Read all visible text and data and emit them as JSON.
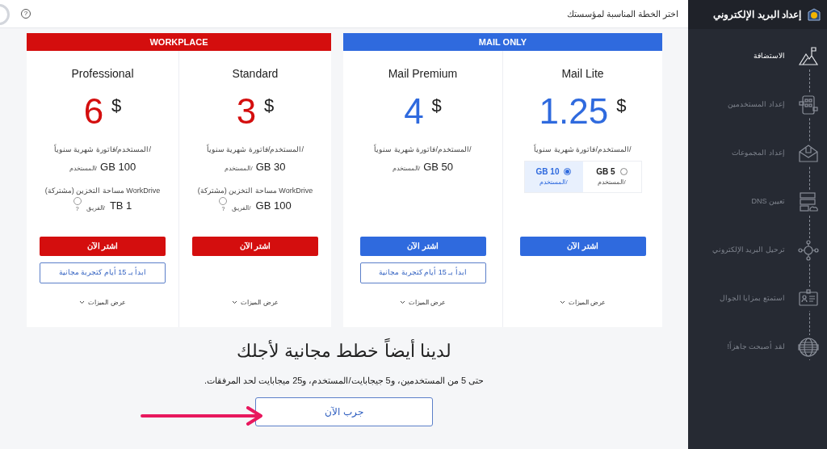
{
  "top_bar": {
    "title": "اختر الخطة المناسبة لمؤسستك",
    "help": "?"
  },
  "plan_groups": [
    {
      "label": "MAIL ONLY",
      "color": "#2f6ade",
      "plans": [
        {
          "name": "Mail Lite",
          "price": "1.25",
          "currency": "$",
          "billing": "/المستخدم/فاتورة شهرية سنوياً",
          "storage_options": [
            {
              "value": "GB 5",
              "unit": "/المستخدم",
              "selected": false
            },
            {
              "value": "GB 10",
              "unit": "/المستخدم",
              "selected": true
            }
          ],
          "buy_button": "اشتر الآن",
          "features_link": "عرض الميزات"
        },
        {
          "name": "Mail Premium",
          "price": "4",
          "currency": "$",
          "billing": "/المستخدم/فاتورة شهرية سنوياً",
          "storage": {
            "value": "GB 50",
            "unit": "/المستخدم"
          },
          "buy_button": "اشتر الآن",
          "trial_button": "ابدأ بـ 15 أيام كتجربة مجانية",
          "features_link": "عرض الميزات"
        }
      ]
    },
    {
      "label": "WORKPLACE",
      "color": "#d40e0e",
      "plans": [
        {
          "name": "Standard",
          "price": "3",
          "currency": "$",
          "billing": "/المستخدم/فاتورة شهرية سنوياً",
          "storage": {
            "value": "GB 30",
            "unit": "/المستخدم"
          },
          "workdrive": {
            "label": "WorkDrive مساحة التخزين (مشتركة)",
            "value": "GB 100",
            "unit": "/الفريق",
            "help": "?",
            "checked": false
          },
          "buy_button": "اشتر الآن",
          "features_link": "عرض الميزات"
        },
        {
          "name": "Professional",
          "price": "6",
          "currency": "$",
          "billing": "/المستخدم/فاتورة شهرية سنوياً",
          "storage": {
            "value": "GB 100",
            "unit": "/المستخدم"
          },
          "workdrive": {
            "label": "WorkDrive مساحة التخزين (مشتركة)",
            "value": "TB 1",
            "unit": "/الفريق",
            "help": "?",
            "checked": false
          },
          "buy_button": "اشتر الآن",
          "trial_button": "ابدأ بـ 15 أيام كتجربة مجانية",
          "features_link": "عرض الميزات"
        }
      ]
    }
  ],
  "free_plans": {
    "heading": "لدينا أيضاً خطط مجانية لأجلك",
    "text": "حتى 5 من المستخدمين، و5 جيجابايت/المستخدم، و25 ميجابايت لحد المرفقات.",
    "button": "جرب الآن"
  },
  "sidebar": {
    "title": "إعداد البريد الإلكتروني",
    "steps": [
      {
        "label": "الاستضافة",
        "selected": true
      },
      {
        "label": "إعداد المستخدمين",
        "selected": false
      },
      {
        "label": "إعداد المجموعات",
        "selected": false
      },
      {
        "label": "تعيين DNS",
        "selected": false
      },
      {
        "label": "ترحيل البريد الإلكتروني",
        "selected": false
      },
      {
        "label": "استمتع بمزايا الجوال",
        "selected": false
      },
      {
        "label": "لقد أصبحت جاهزاً!",
        "selected": false
      }
    ]
  }
}
